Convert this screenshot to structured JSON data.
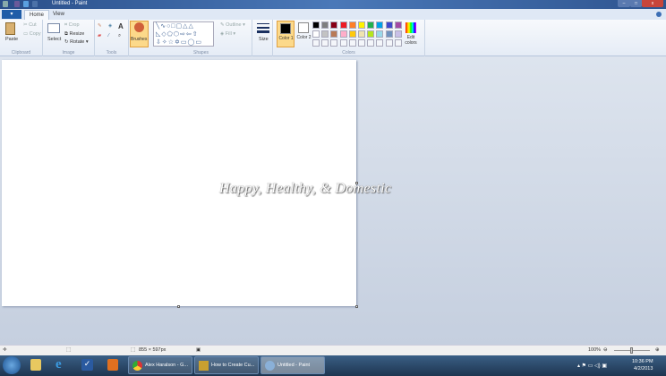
{
  "window": {
    "title": "Untitled - Paint"
  },
  "tabs": {
    "file": "▾",
    "home": "Home",
    "view": "View"
  },
  "clipboard": {
    "paste": "Paste",
    "cut": "Cut",
    "copy": "Copy",
    "label": "Clipboard"
  },
  "image": {
    "select": "Select",
    "crop": "Crop",
    "resize": "Resize",
    "rotate": "Rotate",
    "label": "Image"
  },
  "tools": {
    "label": "Tools"
  },
  "brushes": {
    "label": "Brushes"
  },
  "shapes": {
    "outline": "Outline",
    "fill": "Fill",
    "label": "Shapes"
  },
  "size": {
    "label": "Size"
  },
  "colors": {
    "color1": "Color 1",
    "color2": "Color 2",
    "edit": "Edit colors",
    "label": "Colors",
    "palette_row1": [
      "#000000",
      "#7f7f7f",
      "#880015",
      "#ed1c24",
      "#ff7f27",
      "#fff200",
      "#22b14c",
      "#00a2e8",
      "#3f48cc",
      "#a349a4"
    ],
    "palette_row2": [
      "#ffffff",
      "#c3c3c3",
      "#b97a57",
      "#ffaec9",
      "#ffc90e",
      "#efe4b0",
      "#b5e61d",
      "#99d9ea",
      "#7092be",
      "#c8bfe7"
    ]
  },
  "canvas": {
    "watermark": "Happy, Healthy, & Domestic"
  },
  "status": {
    "size": "855 × 597px",
    "zoom": "100%"
  },
  "taskbar": {
    "tasks": [
      "Alex Haralson - G...",
      "How to Create Cu...",
      "Untitled - Paint"
    ],
    "time": "10:36 PM",
    "date": "4/2/2013"
  }
}
